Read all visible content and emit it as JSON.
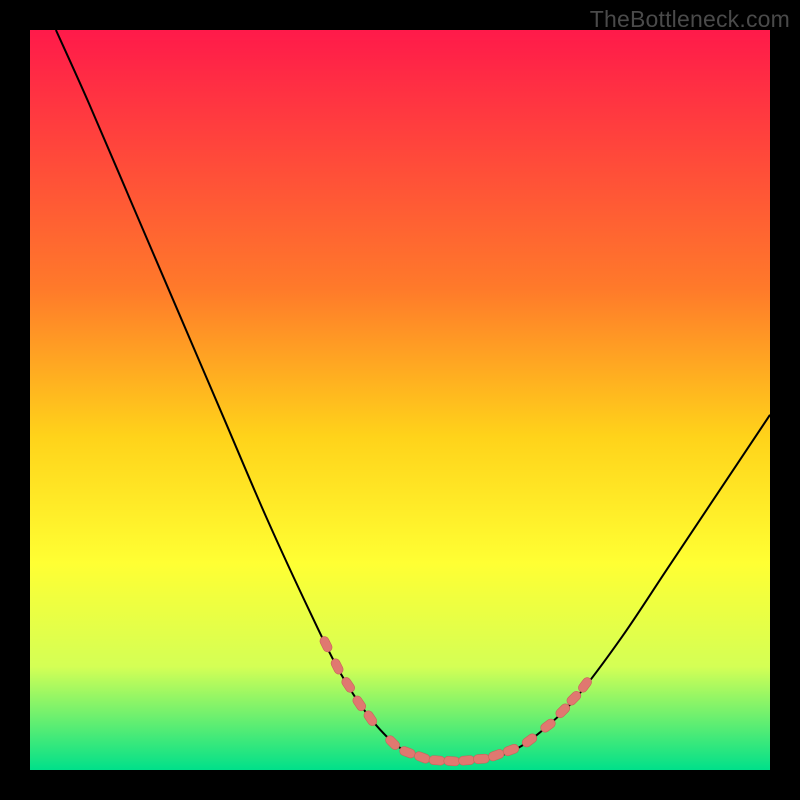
{
  "watermark": "TheBottleneck.com",
  "colors": {
    "background": "#000000",
    "gradient_top": "#ff1a4a",
    "gradient_mid1": "#ff7a2a",
    "gradient_mid2": "#ffd31a",
    "gradient_mid3": "#ffff33",
    "gradient_mid4": "#d4ff55",
    "gradient_bottom": "#00e08a",
    "curve_stroke": "#000000",
    "marker_fill": "#e07870",
    "marker_stroke": "#c9625a",
    "watermark_text": "#4a4a4a"
  },
  "chart_data": {
    "type": "line",
    "title": "",
    "xlabel": "",
    "ylabel": "",
    "x_range": [
      0,
      100
    ],
    "y_range": [
      0,
      100
    ],
    "grid": false,
    "legend": false,
    "background_gradient": {
      "direction": "vertical",
      "stops": [
        {
          "pos": 0.0,
          "color": "#ff1a4a"
        },
        {
          "pos": 0.35,
          "color": "#ff7a2a"
        },
        {
          "pos": 0.55,
          "color": "#ffd31a"
        },
        {
          "pos": 0.72,
          "color": "#ffff33"
        },
        {
          "pos": 0.86,
          "color": "#d4ff55"
        },
        {
          "pos": 1.0,
          "color": "#00e08a"
        }
      ]
    },
    "series": [
      {
        "name": "bottleneck-curve",
        "stroke": "#000000",
        "stroke_width": 2,
        "points": [
          {
            "x": 3.5,
            "y": 100.0
          },
          {
            "x": 8.0,
            "y": 90.0
          },
          {
            "x": 14.0,
            "y": 76.0
          },
          {
            "x": 20.0,
            "y": 62.0
          },
          {
            "x": 26.0,
            "y": 48.0
          },
          {
            "x": 32.0,
            "y": 34.0
          },
          {
            "x": 38.0,
            "y": 21.0
          },
          {
            "x": 42.0,
            "y": 13.0
          },
          {
            "x": 46.0,
            "y": 7.0
          },
          {
            "x": 50.0,
            "y": 3.0
          },
          {
            "x": 54.0,
            "y": 1.5
          },
          {
            "x": 58.0,
            "y": 1.2
          },
          {
            "x": 62.0,
            "y": 1.5
          },
          {
            "x": 66.0,
            "y": 3.0
          },
          {
            "x": 70.0,
            "y": 6.0
          },
          {
            "x": 74.0,
            "y": 10.0
          },
          {
            "x": 80.0,
            "y": 18.0
          },
          {
            "x": 86.0,
            "y": 27.0
          },
          {
            "x": 92.0,
            "y": 36.0
          },
          {
            "x": 100.0,
            "y": 48.0
          }
        ]
      }
    ],
    "markers": {
      "name": "highlighted-points",
      "style": "rounded-dash",
      "color": "#e07870",
      "points": [
        {
          "x": 40.0,
          "y": 17.0
        },
        {
          "x": 41.5,
          "y": 14.0
        },
        {
          "x": 43.0,
          "y": 11.5
        },
        {
          "x": 44.5,
          "y": 9.0
        },
        {
          "x": 46.0,
          "y": 7.0
        },
        {
          "x": 49.0,
          "y": 3.7
        },
        {
          "x": 51.0,
          "y": 2.4
        },
        {
          "x": 53.0,
          "y": 1.7
        },
        {
          "x": 55.0,
          "y": 1.3
        },
        {
          "x": 57.0,
          "y": 1.2
        },
        {
          "x": 59.0,
          "y": 1.3
        },
        {
          "x": 61.0,
          "y": 1.5
        },
        {
          "x": 63.0,
          "y": 2.0
        },
        {
          "x": 65.0,
          "y": 2.7
        },
        {
          "x": 67.5,
          "y": 4.0
        },
        {
          "x": 70.0,
          "y": 6.0
        },
        {
          "x": 72.0,
          "y": 8.0
        },
        {
          "x": 73.5,
          "y": 9.7
        },
        {
          "x": 75.0,
          "y": 11.5
        }
      ]
    }
  }
}
